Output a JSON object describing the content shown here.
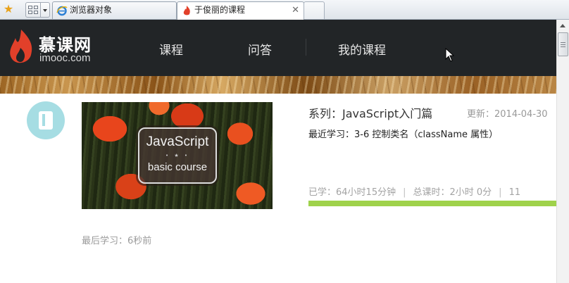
{
  "browser": {
    "tabs": [
      {
        "label": "浏览器对象",
        "active": false
      },
      {
        "label": "于俊丽的课程",
        "active": true
      }
    ],
    "close_glyph": "✕"
  },
  "site": {
    "logo_title": "慕课网",
    "logo_sub": "imooc.com",
    "nav": [
      "课程",
      "问答",
      "我的课程"
    ]
  },
  "course": {
    "thumb_line1": "JavaScript",
    "thumb_dots": "• ★ •",
    "thumb_line2": "basic course",
    "series": "系列：JavaScript入门篇",
    "updated": "更新：2014-04-30",
    "recent": "最近学习：3-6 控制类名（className 属性）",
    "stats_learned": "已学：64小时15分钟",
    "stats_total": "总课时：2小时 0分",
    "stats_extra": "11",
    "stats_sep": "|",
    "progress": 1.0,
    "last_study": "最后学习：6秒前"
  },
  "colors": {
    "header_bg": "#222527",
    "progress": "#9fd24b",
    "avatar_bg": "#a6dde3",
    "brand_red": "#e2402a"
  }
}
